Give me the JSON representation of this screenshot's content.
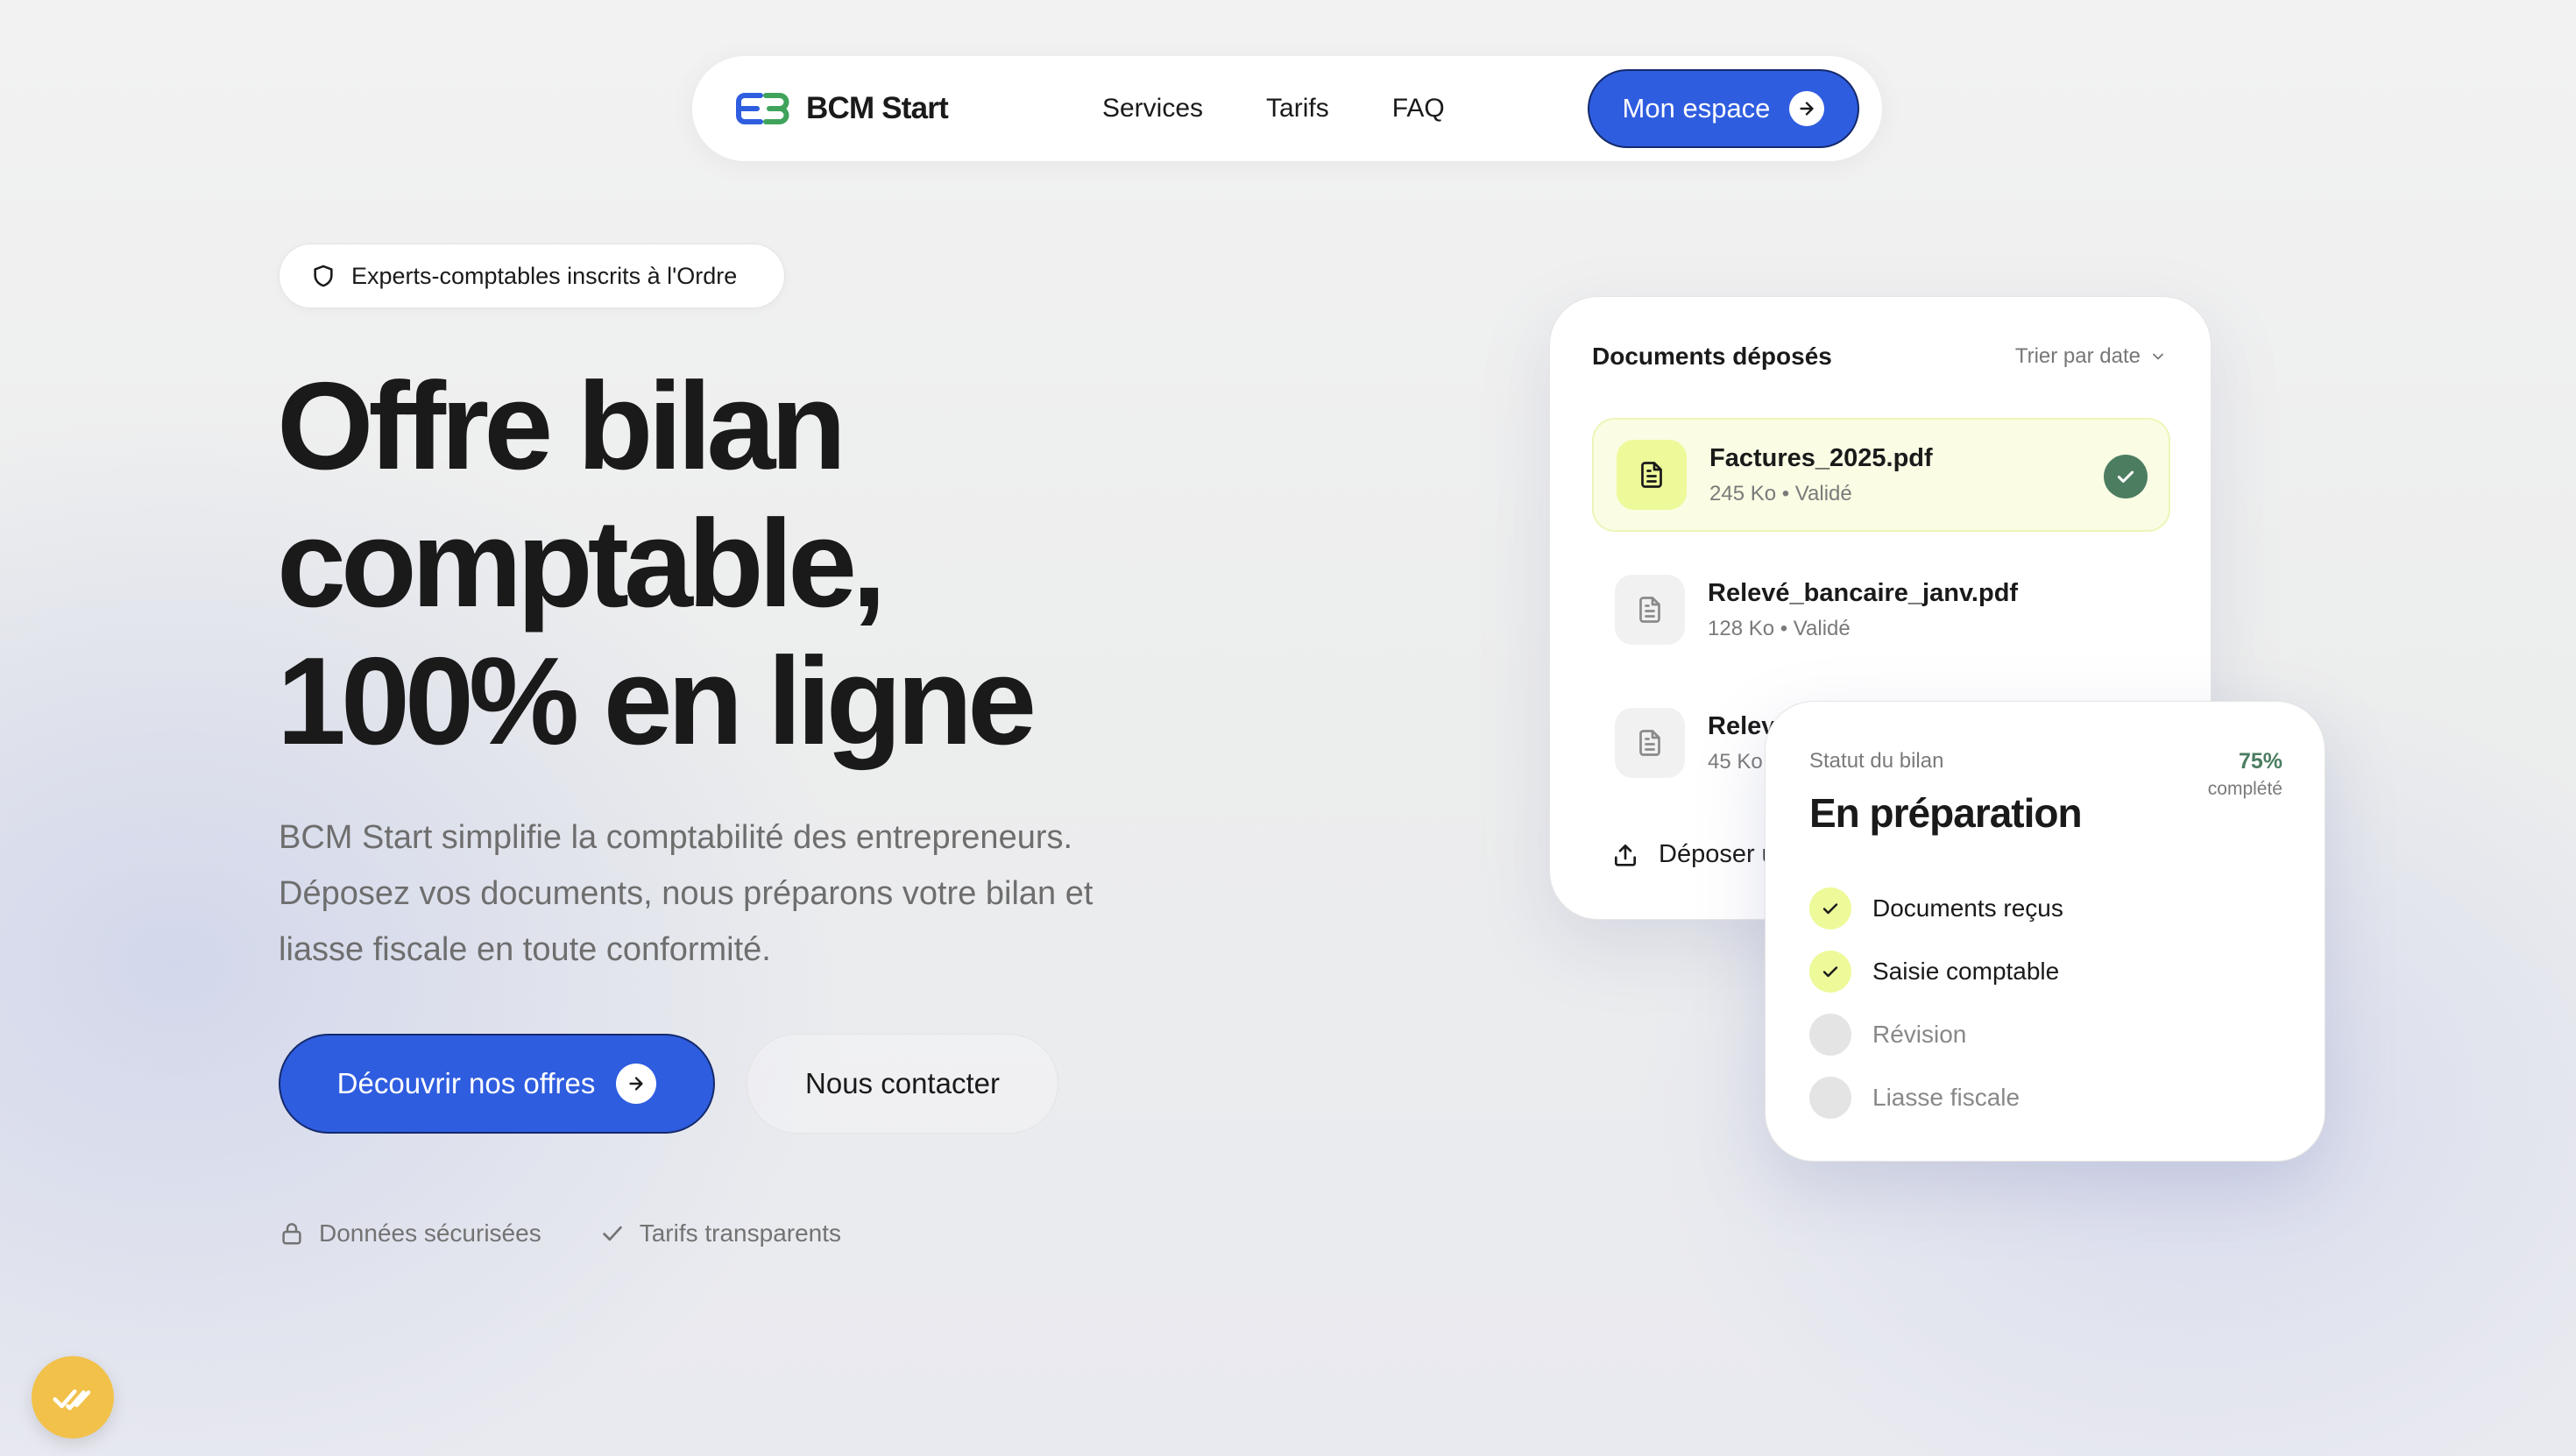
{
  "nav": {
    "brand": "BCM Start",
    "links": [
      "Services",
      "Tarifs",
      "FAQ"
    ],
    "cta": "Mon espace"
  },
  "badge": {
    "text": "Experts-comptables inscrits à l'Ordre",
    "icon": "shield-icon"
  },
  "hero": {
    "title_lines": [
      "Offre bilan",
      "comptable,",
      "100% en ligne"
    ],
    "subtitle": "BCM Start simplifie la comptabilité des entrepreneurs. Déposez vos documents, nous préparons votre bilan et liasse fiscale en toute conformité.",
    "primary_cta": "Découvrir nos offres",
    "secondary_cta": "Nous contacter",
    "features": [
      {
        "icon": "lock-icon",
        "label": "Données sécurisées"
      },
      {
        "icon": "check-icon",
        "label": "Tarifs transparents"
      }
    ]
  },
  "documents": {
    "title": "Documents déposés",
    "sort_label": "Trier par date",
    "items": [
      {
        "name": "Factures_2025.pdf",
        "meta": "245 Ko • Validé"
      },
      {
        "name": "Relevé_bancaire_janv.pdf",
        "meta": "128 Ko • Validé"
      },
      {
        "name": "Relevé",
        "meta": "45 Ko"
      }
    ],
    "upload_label": "Déposer u"
  },
  "status": {
    "label": "Statut du bilan",
    "title": "En préparation",
    "percent": "75%",
    "percent_label": "complété",
    "steps": [
      {
        "label": "Documents reçus",
        "done": true
      },
      {
        "label": "Saisie comptable",
        "done": true
      },
      {
        "label": "Révision",
        "done": false
      },
      {
        "label": "Liasse fiscale",
        "done": false
      }
    ]
  },
  "colors": {
    "accent": "#2f5de0",
    "success": "#4c7d61",
    "highlight": "#eef99a",
    "widget": "#f2c14a"
  }
}
